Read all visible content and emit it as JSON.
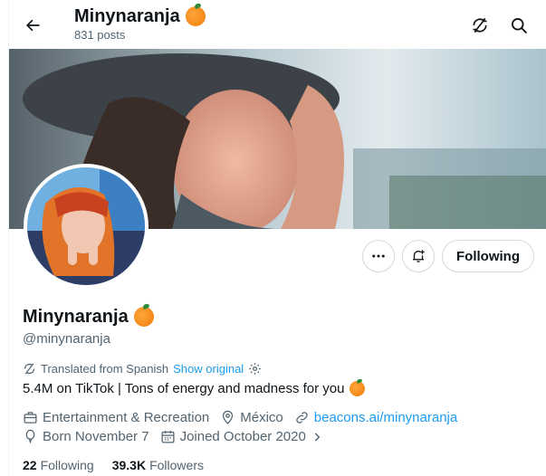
{
  "header": {
    "title": "Minynaranja",
    "posts": "831 posts"
  },
  "profile": {
    "name": "Minynaranja",
    "handle": "@minynaranja",
    "translated_note": "Translated from Spanish",
    "show_original": "Show original",
    "bio": "5.4M on TikTok | Tons of energy and madness for you",
    "category": "Entertainment & Recreation",
    "location": "México",
    "website": "beacons.ai/minynaranja",
    "birthday": "Born November 7",
    "joined": "Joined October 2020",
    "following_count": "22",
    "following_label": "Following",
    "followers_count": "39.3K",
    "followers_label": "Followers"
  },
  "actions": {
    "following_button": "Following"
  },
  "colors": {
    "accent": "#1d9bf0",
    "secondary_text": "#536471",
    "primary_text": "#0f1419",
    "border": "#cfd9de"
  },
  "icons": [
    "back-arrow-icon",
    "translate-icon",
    "search-icon",
    "more-icon",
    "notification-bell-icon",
    "orange-emoji-icon",
    "settings-icon",
    "briefcase-icon",
    "location-pin-icon",
    "link-icon",
    "balloon-icon",
    "calendar-icon",
    "chevron-right-icon"
  ]
}
